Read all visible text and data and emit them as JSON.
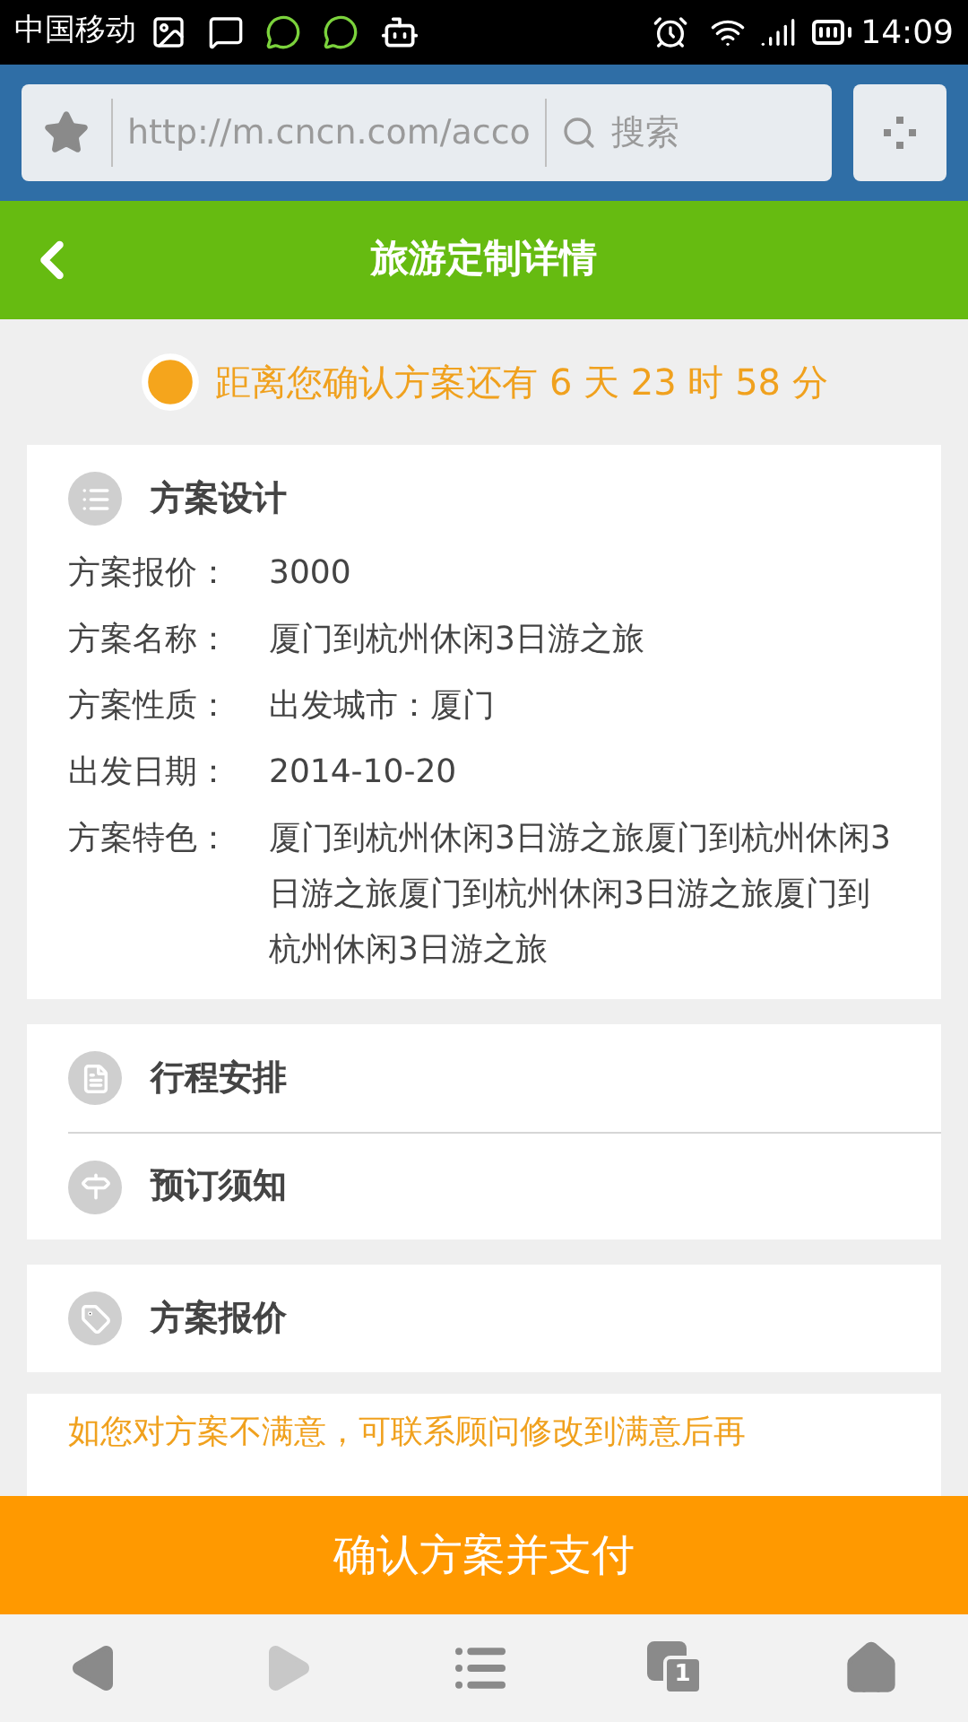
{
  "status_bar": {
    "carrier": "中国移动",
    "time": "14:09"
  },
  "browser": {
    "url": "http://m.cncn.com/acco",
    "search_placeholder": "搜索"
  },
  "header": {
    "title": "旅游定制详情"
  },
  "countdown": {
    "text": "距离您确认方案还有 6 天 23 时 58 分"
  },
  "plan_card": {
    "title": "方案设计",
    "fields": [
      {
        "label": "方案报价：",
        "value": "3000"
      },
      {
        "label": "方案名称：",
        "value": "厦门到杭州休闲3日游之旅"
      },
      {
        "label": "方案性质：",
        "value": "出发城市：厦门"
      },
      {
        "label": "出发日期：",
        "value": "2014-10-20"
      },
      {
        "label": "方案特色：",
        "value": "厦门到杭州休闲3日游之旅厦门到杭州休闲3日游之旅厦门到杭州休闲3日游之旅厦门到杭州休闲3日游之旅"
      }
    ]
  },
  "section_groups": [
    [
      {
        "kind": "itinerary",
        "title": "行程安排"
      },
      {
        "kind": "notice",
        "title": "预订须知"
      }
    ],
    [
      {
        "kind": "price",
        "title": "方案报价"
      }
    ]
  ],
  "note": {
    "text": "如您对方案不满意，可联系顾问修改到满意后再"
  },
  "pay_button": {
    "label": "确认方案并支付"
  },
  "nav": {
    "tab_count": "1"
  }
}
